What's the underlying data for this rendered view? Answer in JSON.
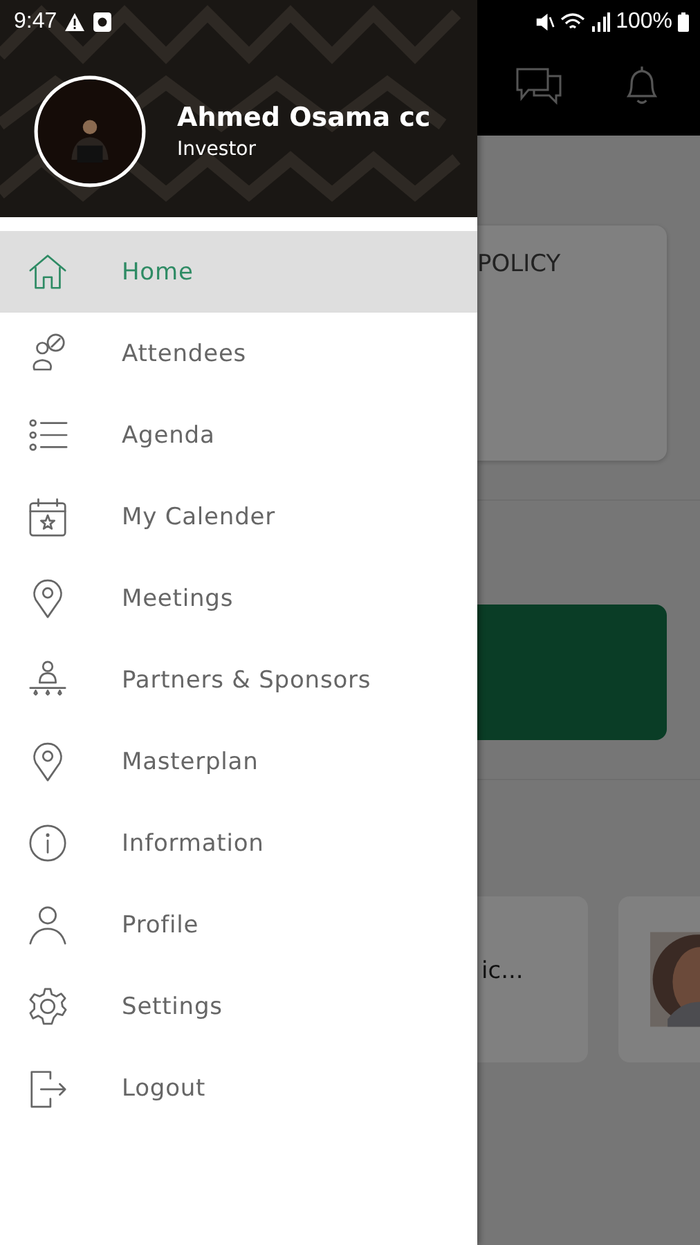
{
  "status_bar": {
    "time": "9:47",
    "battery": "100%"
  },
  "profile": {
    "name": "Ahmed Osama cc",
    "role": "Investor"
  },
  "menu": [
    {
      "label": "Home",
      "selected": true
    },
    {
      "label": "Attendees",
      "selected": false
    },
    {
      "label": "Agenda",
      "selected": false
    },
    {
      "label": "My Calender",
      "selected": false
    },
    {
      "label": "Meetings",
      "selected": false
    },
    {
      "label": "Partners & Sponsors",
      "selected": false
    },
    {
      "label": "Masterplan",
      "selected": false
    },
    {
      "label": "Information",
      "selected": false
    },
    {
      "label": "Profile",
      "selected": false
    },
    {
      "label": "Settings",
      "selected": false
    },
    {
      "label": "Logout",
      "selected": false
    }
  ],
  "background": {
    "card_title": "POLICY",
    "card_text": "ic..."
  }
}
